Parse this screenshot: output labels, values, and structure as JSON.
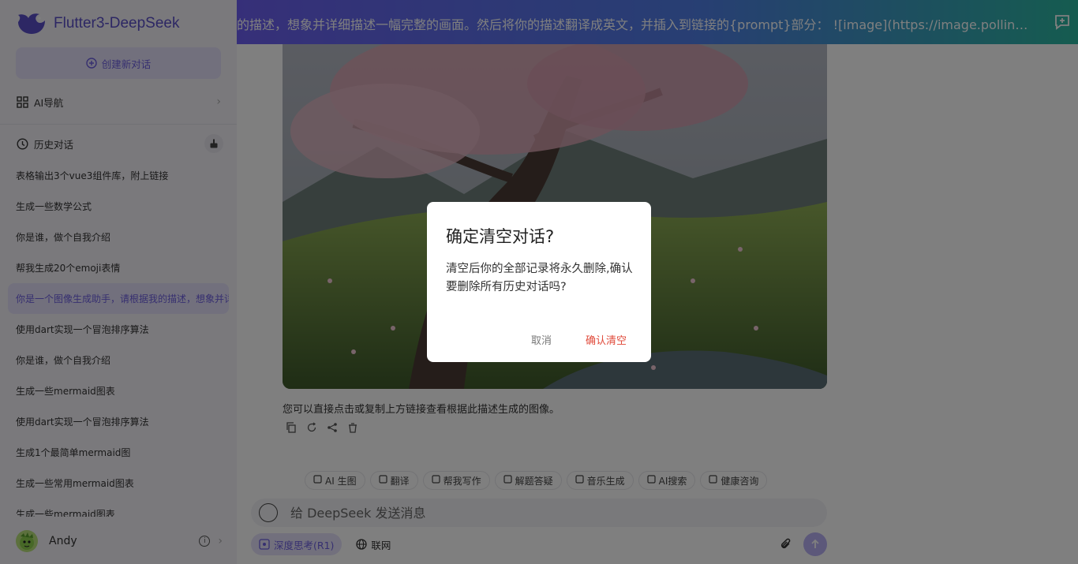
{
  "app": {
    "title": "Flutter3-DeepSeek"
  },
  "sidebar": {
    "new_chat": "创建新对话",
    "ai_nav": "AI导航",
    "history_title": "历史对话",
    "history": [
      "表格输出3个vue3组件库，附上链接",
      "生成一些数学公式",
      "你是谁，做个自我介绍",
      "帮我生成20个emoji表情",
      "你是一个图像生成助手，请根据我的描述，想象并详细描述一幅完整的画面。",
      "使用dart实现一个冒泡排序算法",
      "你是谁，做个自我介绍",
      "生成一些mermaid图表",
      "使用dart实现一个冒泡排序算法",
      "生成1个最简单mermaid图",
      "生成一些常用mermaid图表",
      "生成一些mermaid图表"
    ],
    "active_index": 4,
    "user": "Andy"
  },
  "header": {
    "title": "的描述，想象并详细描述一幅完整的画面。然后将你的描述翻译成英文，并插入到链接的{prompt}部分： ![image](https://image.pollinations.ai/pr…"
  },
  "message": {
    "caption": "您可以直接点击或复制上方链接查看根据此描述生成的图像。"
  },
  "chips": [
    "AI 生图",
    "翻译",
    "帮我写作",
    "解题答疑",
    "音乐生成",
    "AI搜索",
    "健康咨询"
  ],
  "chip_icons": [
    "image-icon",
    "translate-icon",
    "write-icon",
    "solve-icon",
    "music-icon",
    "search-icon",
    "health-icon"
  ],
  "composer": {
    "placeholder": "给 DeepSeek 发送消息",
    "deep_think": "深度思考(R1)",
    "web_search": "联网"
  },
  "dialog": {
    "title": "确定清空对话?",
    "message": "清空后你的全部记录将永久删除,确认要删除所有历史对话吗?",
    "cancel": "取消",
    "confirm": "确认清空"
  },
  "colors": {
    "accent": "#6d5fe0",
    "danger": "#e04a3a"
  }
}
